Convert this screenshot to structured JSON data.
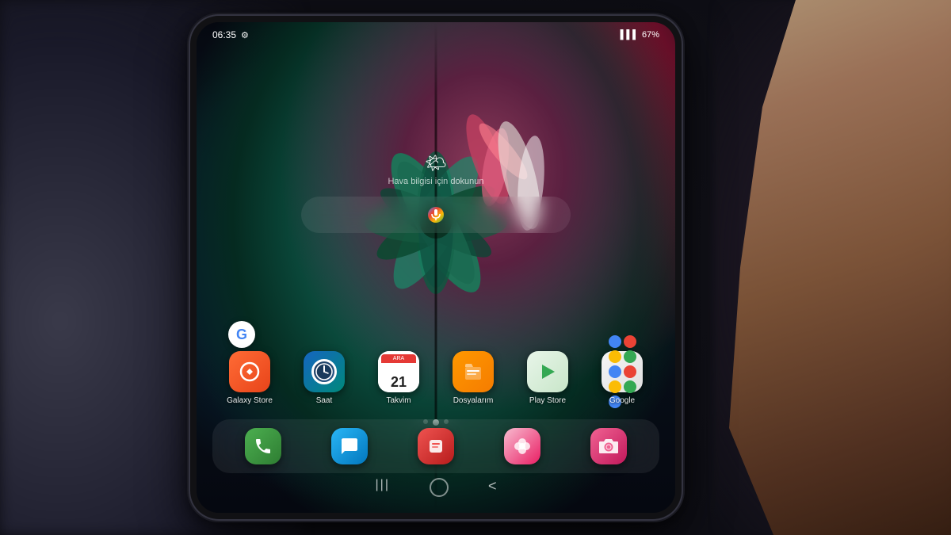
{
  "scene": {
    "background_desc": "Dark blurred room background with hand holding Samsung Galaxy Z Fold 3"
  },
  "phone": {
    "status_bar": {
      "time": "06:35",
      "settings_icon": "⚙",
      "signal": "▌▌▌",
      "battery": "67%",
      "battery_icon": "🔋"
    },
    "weather": {
      "icon": "🌤",
      "text": "Hava bilgisi için dokunun"
    },
    "app_rows": [
      {
        "row": 1,
        "apps": [
          {
            "id": "galaxy-store",
            "label": "Galaxy Store",
            "color_from": "#ff6b35",
            "color_to": "#e8441a"
          },
          {
            "id": "saat",
            "label": "Saat",
            "color_from": "#2196f3",
            "color_to": "#00bcd4"
          },
          {
            "id": "takvim",
            "label": "Takvim",
            "color_from": "#ffffff",
            "color_to": "#e0e0e0",
            "calendar_date": "21"
          },
          {
            "id": "dosyalarim",
            "label": "Dosyalarım",
            "color_from": "#ff9800",
            "color_to": "#f57c00"
          },
          {
            "id": "play-store",
            "label": "Play Store",
            "color_from": "#ffffff",
            "color_to": "#f5f5f5"
          },
          {
            "id": "google",
            "label": "Google",
            "color_from": "#ffffff",
            "color_to": "#e8e8e8"
          }
        ]
      },
      {
        "row": 2,
        "apps": [
          {
            "id": "phone",
            "label": "",
            "color_from": "#4caf50",
            "color_to": "#388e3c"
          },
          {
            "id": "messages",
            "label": "",
            "color_from": "#29b6f6",
            "color_to": "#0288d1"
          },
          {
            "id": "bixby",
            "label": "",
            "color_from": "#ef5350",
            "color_to": "#c62828"
          },
          {
            "id": "galaxy-flower",
            "label": "",
            "color_from": "#f8bbd0",
            "color_to": "#e91e63"
          },
          {
            "id": "camera",
            "label": "",
            "color_from": "#f06292",
            "color_to": "#e91e63"
          }
        ]
      }
    ],
    "dots": [
      false,
      true,
      false
    ],
    "nav_buttons": [
      "|||",
      "○",
      "<"
    ]
  }
}
